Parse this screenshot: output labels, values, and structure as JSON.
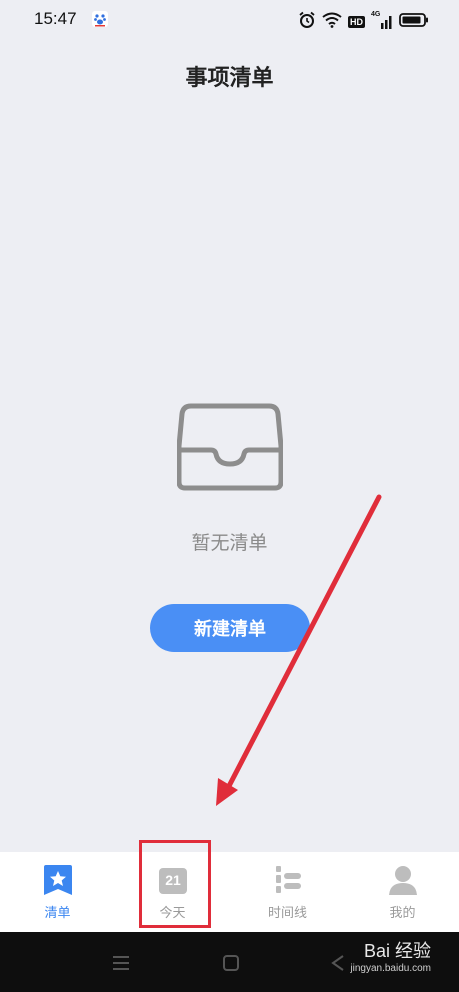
{
  "status_bar": {
    "time": "15:47",
    "network": "4G",
    "hd": "HD",
    "icons": [
      "baidu-paw-icon",
      "alarm-icon",
      "wifi-icon",
      "signal-icon",
      "battery-icon"
    ]
  },
  "header": {
    "title": "事项清单"
  },
  "empty_state": {
    "icon": "inbox-tray-icon",
    "message": "暂无清单",
    "button_label": "新建清单"
  },
  "tab_bar": {
    "active_color": "#3b86f0",
    "tabs": [
      {
        "label": "清单",
        "icon": "star-list-icon",
        "active": true
      },
      {
        "label": "今天",
        "icon": "calendar-day-icon",
        "day": "21",
        "active": false
      },
      {
        "label": "时间线",
        "icon": "timeline-icon",
        "active": false
      },
      {
        "label": "我的",
        "icon": "user-icon",
        "active": false
      }
    ]
  },
  "watermark": {
    "brand": "Bai 经验",
    "url": "jingyan.baidu.com"
  },
  "colors": {
    "accent": "#4a8ff5",
    "annotation": "#e02d3a",
    "background": "#edeef3"
  }
}
